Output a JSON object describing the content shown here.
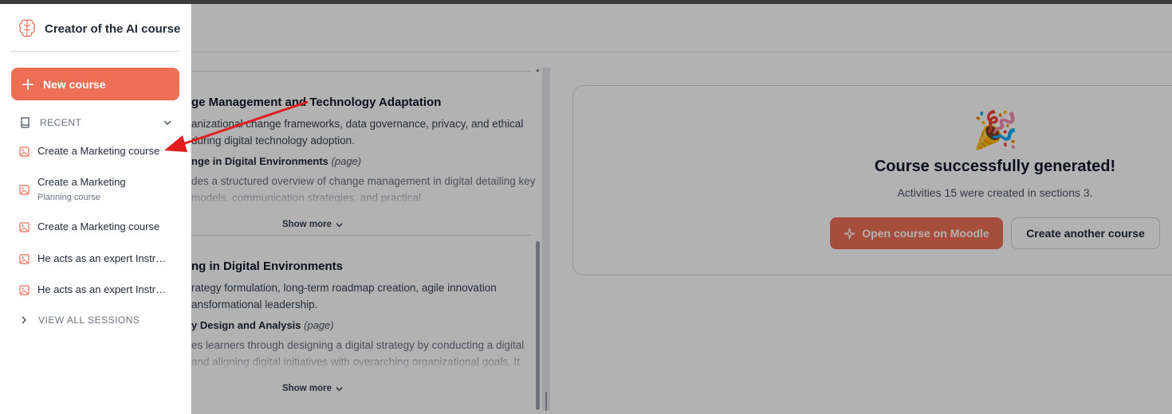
{
  "app": {
    "title": "Creator of the AI course",
    "accent_color": "#ef6f56"
  },
  "sidebar": {
    "new_course_label": "New course",
    "recent_label": "RECENT",
    "sessions": [
      {
        "label": "Create a Marketing course",
        "sub": ""
      },
      {
        "label": "Create a Marketing",
        "sub": "Planning course"
      },
      {
        "label": "Create a Marketing course",
        "sub": ""
      },
      {
        "label": "He acts as an expert Instructional Designer",
        "sub": ""
      },
      {
        "label": "He acts as an expert Instructional Designer",
        "sub": ""
      }
    ],
    "view_all_label": "VIEW ALL SESSIONS"
  },
  "content": {
    "sections": [
      {
        "title": "ge Management and Technology Adaptation",
        "description": "anizational change frameworks, data governance, privacy, and ethical during digital technology adoption.",
        "activity_title": "nge in Digital Environments",
        "activity_type": "(page)",
        "activity_desc": "des a structured overview of change management in digital detailing key models, communication strategies, and practical",
        "show_more": "Show more"
      },
      {
        "title": "ng in Digital Environments",
        "description": "rategy formulation, long-term roadmap creation, agile innovation ansformational leadership.",
        "activity_title": "y Design and Analysis",
        "activity_type": "(page)",
        "activity_desc": "es learners through designing a digital strategy by conducting a digital and aligning digital initiatives with overarching organizational goals. It",
        "show_more": "Show more"
      }
    ]
  },
  "result": {
    "emoji": "🎉",
    "title": "Course successfully generated!",
    "subtitle": "Activities 15 were created in sections 3.",
    "open_button": "Open course on Moodle",
    "another_button": "Create another course"
  }
}
